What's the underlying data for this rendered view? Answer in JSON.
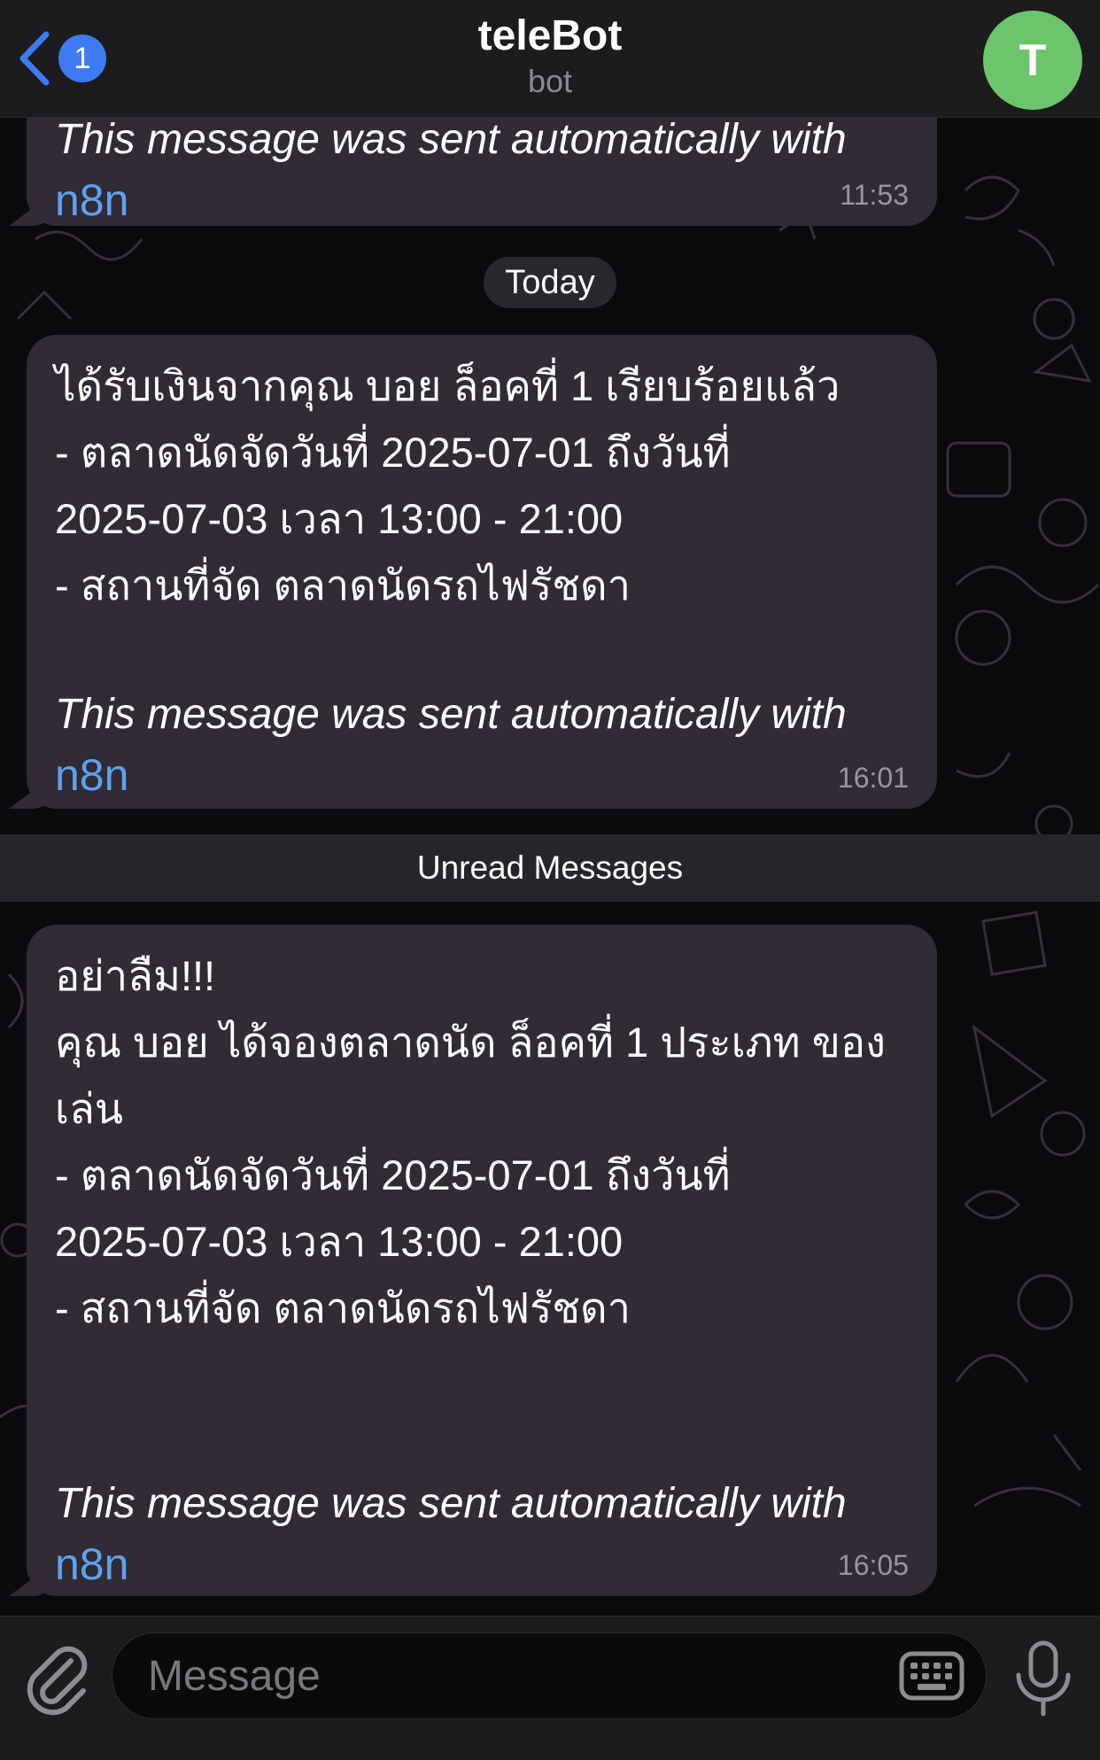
{
  "header": {
    "back_badge": "1",
    "title": "teleBot",
    "subtitle": "bot",
    "avatar_initial": "T"
  },
  "messages": [
    {
      "partial_top_line": "This message was sent automatically with",
      "link": "n8n",
      "time": "11:53"
    },
    {
      "lines": [
        "ได้รับเงินจากคุณ บอย ล็อคที่ 1 เรียบร้อยแล้ว",
        "- ตลาดนัดจัดวันที่  2025-07-01 ถึงวันที่",
        "2025-07-03 เวลา 13:00 - 21:00",
        "- สถานที่จัด ตลาดนัดรถไฟรัชดา"
      ],
      "footer": "This message was sent automatically with",
      "link": "n8n",
      "time": "16:01"
    },
    {
      "lines": [
        "อย่าลืม!!!",
        "คุณ บอย ได้จองตลาดนัด ล็อคที่ 1 ประเภท ของ",
        "เล่น",
        "- ตลาดนัดจัดวันที่ 2025-07-01 ถึงวันที่",
        "2025-07-03 เวลา 13:00 - 21:00",
        "- สถานที่จัด ตลาดนัดรถไฟรัชดา"
      ],
      "footer": "This message was sent automatically with",
      "link": "n8n",
      "time": "16:05"
    }
  ],
  "date_separator": "Today",
  "unread_banner": "Unread Messages",
  "composer": {
    "placeholder": "Message",
    "icons": [
      "paperclip-icon",
      "keyboard-icon",
      "microphone-icon"
    ]
  },
  "colors": {
    "accent": "#3e7bf2",
    "link": "#5fa1ee",
    "avatar": "#6cc46c",
    "bubble": "#302b35"
  }
}
